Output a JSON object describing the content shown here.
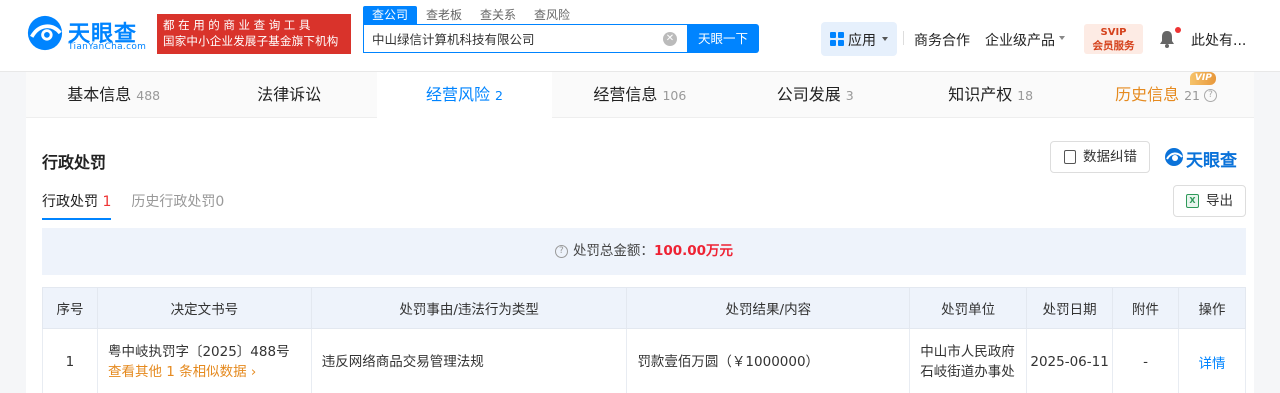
{
  "header": {
    "logo_cn": "天眼查",
    "logo_en": "TianYanCha.com",
    "slogan_line1": "都在用的商业查询工具",
    "slogan_line2": "国家中小企业发展子基金旗下机构",
    "search_tabs": [
      "查公司",
      "查老板",
      "查关系",
      "查风险"
    ],
    "search_value": "中山绿信计算机科技有限公司",
    "search_button": "天眼一下",
    "nav": {
      "apps": "应用",
      "business": "商务合作",
      "enterprise": "企业级产品",
      "svip_top": "SVIP",
      "svip_bottom": "会员服务",
      "user": "此处有..."
    }
  },
  "tabs": [
    {
      "label": "基本信息",
      "count": "488"
    },
    {
      "label": "法律诉讼",
      "count": ""
    },
    {
      "label": "经营风险",
      "count": "2"
    },
    {
      "label": "经营信息",
      "count": "106"
    },
    {
      "label": "公司发展",
      "count": "3"
    },
    {
      "label": "知识产权",
      "count": "18"
    },
    {
      "label": "历史信息",
      "count": "21",
      "badge": "VIP"
    }
  ],
  "section": {
    "title": "行政处罚",
    "correct_button": "数据纠错",
    "watermark": "天眼查",
    "subtabs": [
      {
        "label": "行政处罚",
        "count": "1"
      },
      {
        "label": "历史行政处罚",
        "count": "0"
      }
    ],
    "export_button": "导出",
    "summary_label": "处罚总金额：",
    "summary_amount": "100.00万元"
  },
  "table": {
    "headers": [
      "序号",
      "决定文书号",
      "处罚事由/违法行为类型",
      "处罚结果/内容",
      "处罚单位",
      "处罚日期",
      "附件",
      "操作"
    ],
    "rows": [
      {
        "index": "1",
        "doc_no": "粤中岐执罚字〔2025〕488号",
        "similar": "查看其他 1 条相似数据",
        "reason": "违反网络商品交易管理法规",
        "result": "罚款壹佰万圆（￥1000000）",
        "unit": "中山市人民政府石岐街道办事处",
        "date": "2025-06-11",
        "attachment": "-",
        "action": "详情"
      }
    ]
  }
}
